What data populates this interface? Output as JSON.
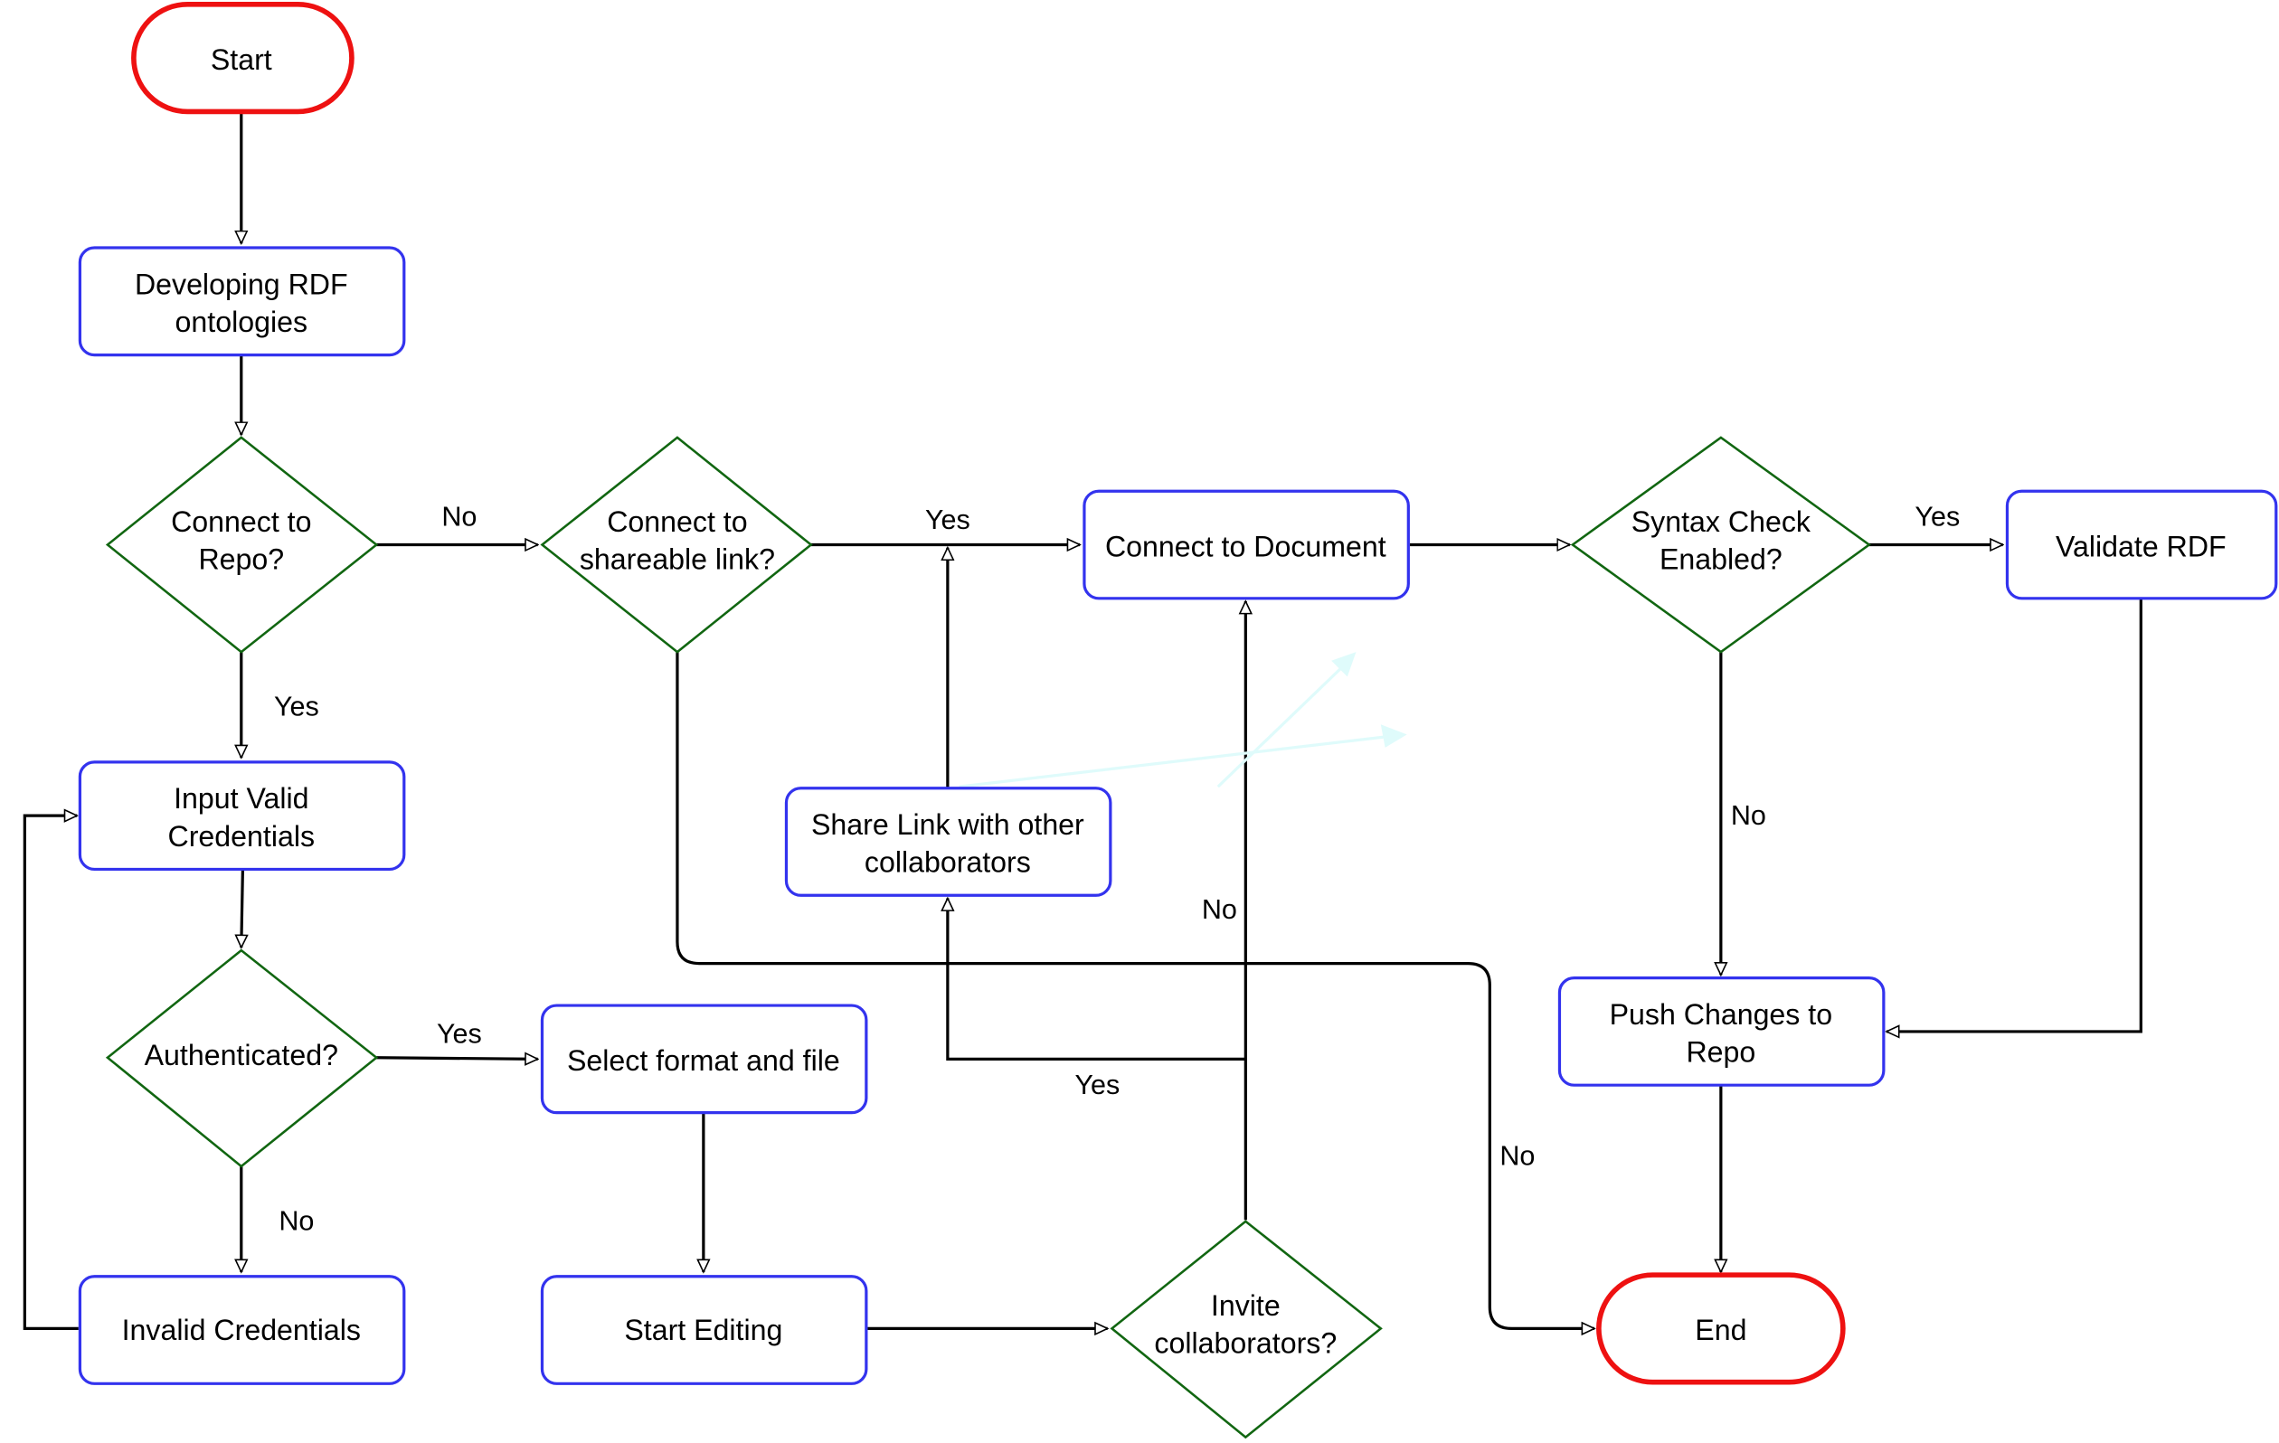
{
  "nodes": {
    "start": {
      "type": "terminal",
      "lines": [
        "Start"
      ]
    },
    "develop": {
      "type": "process",
      "lines": [
        "Developing RDF",
        "ontologies"
      ]
    },
    "connect_repo": {
      "type": "decision",
      "lines": [
        "Connect to",
        "Repo?"
      ]
    },
    "connect_link": {
      "type": "decision",
      "lines": [
        "Connect to",
        "shareable link?"
      ]
    },
    "connect_doc": {
      "type": "process",
      "lines": [
        "Connect to Document"
      ]
    },
    "syntax_check": {
      "type": "decision",
      "lines": [
        "Syntax Check",
        "Enabled?"
      ]
    },
    "validate": {
      "type": "process",
      "lines": [
        "Validate RDF"
      ]
    },
    "input_creds": {
      "type": "process",
      "lines": [
        "Input Valid",
        "Credentials"
      ]
    },
    "share_link": {
      "type": "process",
      "lines": [
        "Share Link with other",
        "collaborators"
      ]
    },
    "authenticated": {
      "type": "decision",
      "lines": [
        "Authenticated?"
      ]
    },
    "select_format": {
      "type": "process",
      "lines": [
        "Select format and file"
      ]
    },
    "push_changes": {
      "type": "process",
      "lines": [
        "Push Changes to",
        "Repo"
      ]
    },
    "invalid_creds": {
      "type": "process",
      "lines": [
        "Invalid Credentials"
      ]
    },
    "start_editing": {
      "type": "process",
      "lines": [
        "Start Editing"
      ]
    },
    "invite": {
      "type": "decision",
      "lines": [
        "Invite",
        "collaborators?"
      ]
    },
    "end": {
      "type": "terminal",
      "lines": [
        "End"
      ]
    }
  },
  "edges": [
    {
      "from": "start",
      "to": "develop",
      "label": ""
    },
    {
      "from": "develop",
      "to": "connect_repo",
      "label": ""
    },
    {
      "from": "connect_repo",
      "to": "connect_link",
      "label": "No"
    },
    {
      "from": "connect_repo",
      "to": "input_creds",
      "label": "Yes"
    },
    {
      "from": "connect_link",
      "to": "connect_doc",
      "label": "Yes"
    },
    {
      "from": "connect_link",
      "to": "end",
      "label": "No"
    },
    {
      "from": "connect_doc",
      "to": "syntax_check",
      "label": ""
    },
    {
      "from": "syntax_check",
      "to": "validate",
      "label": "Yes"
    },
    {
      "from": "syntax_check",
      "to": "push_changes",
      "label": "No"
    },
    {
      "from": "validate",
      "to": "push_changes",
      "label": ""
    },
    {
      "from": "push_changes",
      "to": "end",
      "label": ""
    },
    {
      "from": "input_creds",
      "to": "authenticated",
      "label": ""
    },
    {
      "from": "authenticated",
      "to": "select_format",
      "label": "Yes"
    },
    {
      "from": "authenticated",
      "to": "invalid_creds",
      "label": "No"
    },
    {
      "from": "invalid_creds",
      "to": "input_creds",
      "label": ""
    },
    {
      "from": "select_format",
      "to": "start_editing",
      "label": ""
    },
    {
      "from": "start_editing",
      "to": "invite",
      "label": ""
    },
    {
      "from": "invite",
      "to": "share_link",
      "label": "Yes"
    },
    {
      "from": "invite",
      "to": "connect_doc",
      "label": "No"
    },
    {
      "from": "share_link",
      "to": "connect_doc",
      "label": ""
    }
  ],
  "labels": {
    "repo_no": "No",
    "repo_yes": "Yes",
    "link_yes": "Yes",
    "link_no": "No",
    "syntax_yes": "Yes",
    "syntax_no": "No",
    "auth_yes": "Yes",
    "auth_no": "No",
    "invite_yes": "Yes",
    "invite_no": "No"
  },
  "colors": {
    "terminal_stroke": "#ee1111",
    "process_stroke": "#3333ee",
    "decision_stroke": "#116611",
    "edge": "#000000"
  }
}
